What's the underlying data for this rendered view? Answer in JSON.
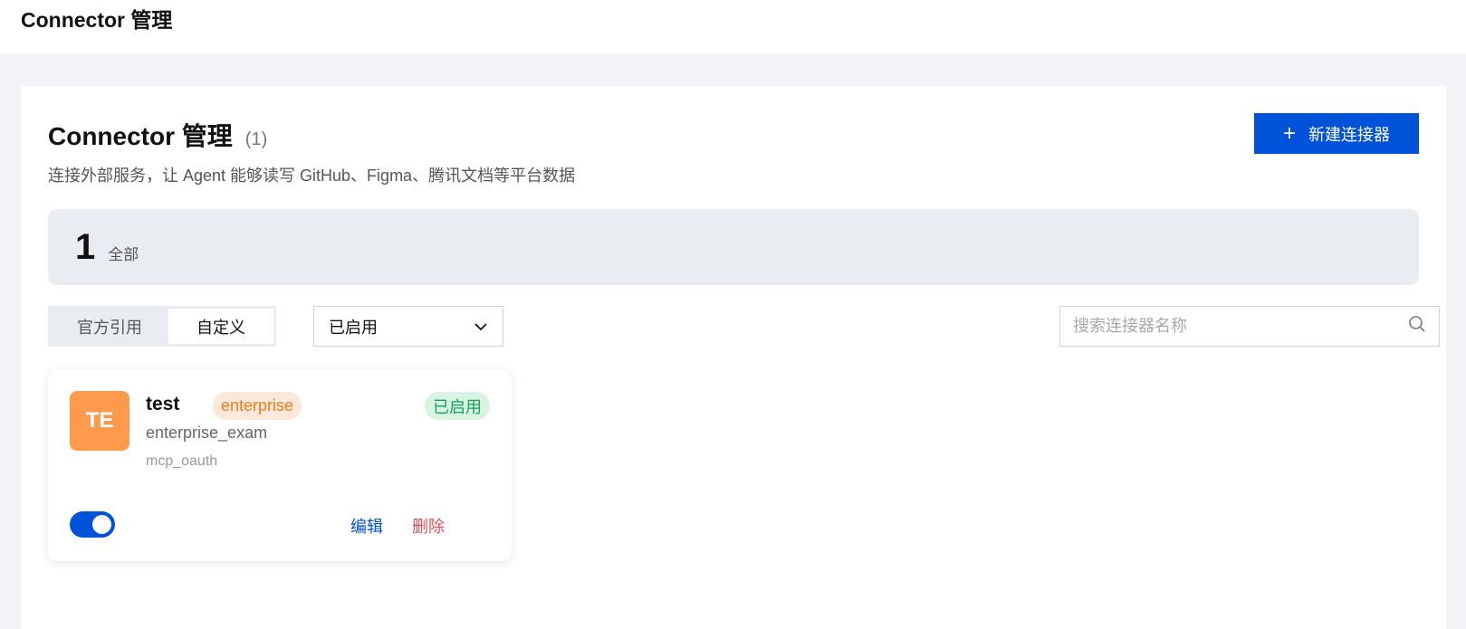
{
  "topbar": {
    "title": "Connector 管理"
  },
  "header": {
    "title": "Connector 管理",
    "count": "(1)",
    "subtitle": "连接外部服务，让 Agent 能够读写 GitHub、Figma、腾讯文档等平台数据",
    "new_button_label": "新建连接器",
    "new_button_icon": "plus-icon"
  },
  "stats": {
    "number": "1",
    "label": "全部"
  },
  "filters": {
    "segments": [
      {
        "label": "官方引用",
        "active": false
      },
      {
        "label": "自定义",
        "active": true
      }
    ],
    "status_select": {
      "value": "已启用"
    },
    "search": {
      "placeholder": "搜索连接器名称",
      "value": ""
    }
  },
  "connectors": [
    {
      "avatar_text": "TE",
      "avatar_color": "#ff9a4d",
      "name": "test",
      "tag": "enterprise",
      "status": "已启用",
      "id": "enterprise_exam",
      "type": "mcp_oauth",
      "enabled": true,
      "edit_label": "编辑",
      "delete_label": "删除"
    }
  ],
  "colors": {
    "primary": "#0052d9",
    "danger": "#e34d59",
    "success": "#17a356",
    "warning": "#f07a1d"
  }
}
